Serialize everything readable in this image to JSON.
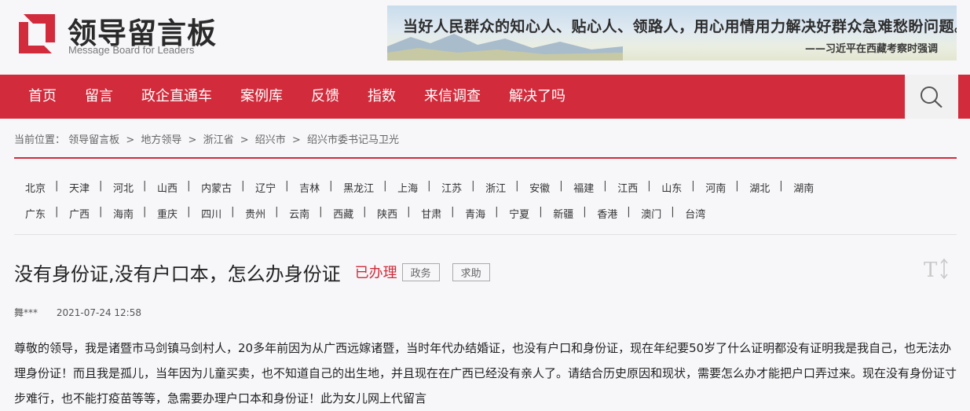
{
  "header": {
    "logo_title": "领导留言板",
    "logo_subtitle": "Message Board for Leaders",
    "banner_quote": "当好人民群众的知心人、贴心人、领路人，用心用情用力解决好群众急难愁盼问题。",
    "banner_source": "——习近平在西藏考察时强调"
  },
  "nav": {
    "items": [
      "首页",
      "留言",
      "政企直通车",
      "案例库",
      "反馈",
      "指数",
      "来信调查",
      "解决了吗"
    ]
  },
  "breadcrumb": {
    "prefix": "当前位置：",
    "items": [
      "领导留言板",
      "地方领导",
      "浙江省",
      "绍兴市",
      "绍兴市委书记马卫光"
    ],
    "separator": ">"
  },
  "provinces": {
    "row1": [
      "北京",
      "天津",
      "河北",
      "山西",
      "内蒙古",
      "辽宁",
      "吉林",
      "黑龙江",
      "上海",
      "江苏",
      "浙江",
      "安徽",
      "福建",
      "江西",
      "山东",
      "河南",
      "湖北",
      "湖南"
    ],
    "row2": [
      "广东",
      "广西",
      "海南",
      "重庆",
      "四川",
      "贵州",
      "云南",
      "西藏",
      "陕西",
      "甘肃",
      "青海",
      "宁夏",
      "新疆",
      "香港",
      "澳门",
      "台湾"
    ]
  },
  "message": {
    "title": "没有身份证,没有户口本，怎么办身份证",
    "status": "已办理",
    "tags": [
      "政务",
      "求助"
    ],
    "author": "舞***",
    "time": "2021-07-24 12:58",
    "content": "尊敬的领导，我是诸暨市马剑镇马剑村人，20多年前因为从广西远嫁诸暨，当时年代办结婚证，也没有户口和身份证，现在年纪要50岁了什么证明都没有证明我是我自己，也无法办理身份证！而且我是孤儿，当年因为儿童买卖，也不知道自己的出生地，并且现在在广西已经没有亲人了。请结合历史原因和现状，需要怎么办才能把户口弄过来。现在没有身份证寸步难行，也不能打疫苗等等，急需要办理户口本和身份证！此为女儿网上代留言"
  },
  "colors": {
    "brand_red": "#d22b3b",
    "status_red": "#d22b3b"
  },
  "icons": {
    "search": "search-icon",
    "font_size": "font-size-icon"
  }
}
